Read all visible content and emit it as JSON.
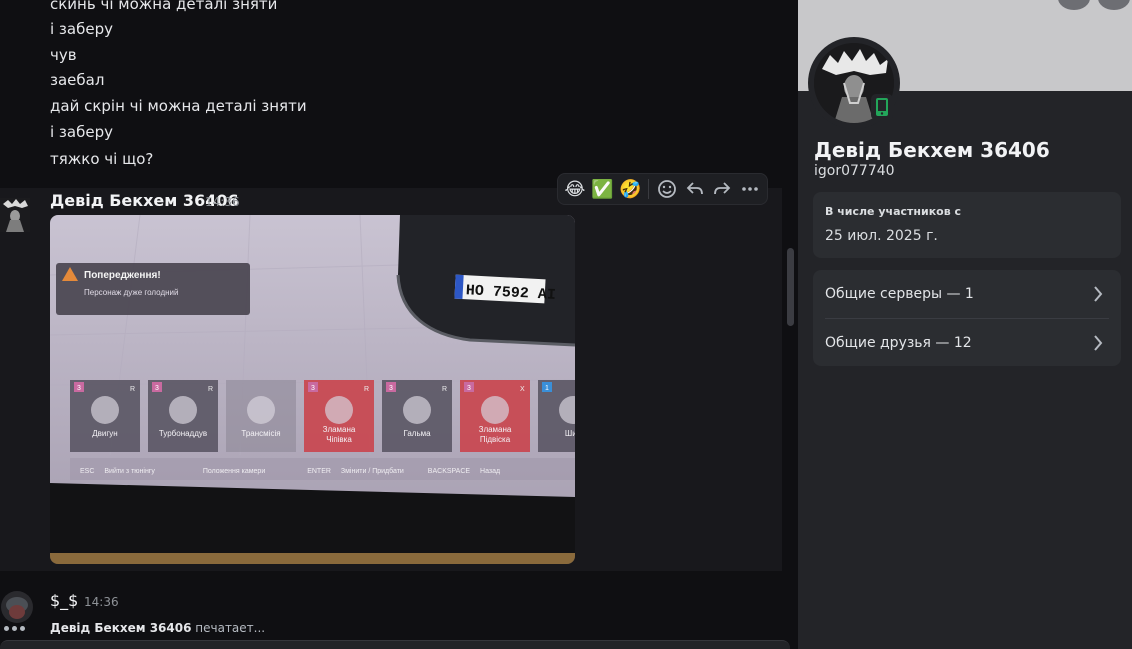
{
  "messages_above": [
    "скинь чі можна деталі зняти",
    "і заберу",
    "чув",
    "заебал",
    "дай скрін чі можна деталі зняти",
    "і заберу",
    "тяжко чі що?"
  ],
  "group": {
    "author": "Девід Бекхем  36406",
    "time": "14:36"
  },
  "attachment": {
    "warning_title": "Попередження!",
    "warning_text": "Персонаж дуже голодний",
    "plate": "НО 7592 АІ",
    "parts": [
      {
        "label": "Двигун",
        "badge": "3",
        "tag": "R"
      },
      {
        "label": "Турбонаддув",
        "badge": "3",
        "tag": "R"
      },
      {
        "label": "Трансмісія",
        "badge": "",
        "tag": ""
      },
      {
        "label": "Зламана Чіпівка",
        "badge": "3",
        "tag": "R"
      },
      {
        "label": "Гальма",
        "badge": "3",
        "tag": "R"
      },
      {
        "label": "Зламана Підвіска",
        "badge": "3",
        "tag": "X"
      },
      {
        "label": "Шин",
        "badge": "1",
        "tag": ""
      }
    ],
    "hint_bar": [
      "ESC",
      "Вийти з тюнінгу",
      "Положення камери",
      "ENTER",
      "Змінити / Придбати",
      "BACKSPACE",
      "Назад"
    ]
  },
  "toolbar": {
    "reactions": [
      "😂",
      "✅",
      "🤣"
    ],
    "icons": [
      "add-reaction-icon",
      "reply-icon",
      "forward-icon",
      "more-icon"
    ]
  },
  "message2": {
    "author": "$_$",
    "time": "14:36"
  },
  "typing": {
    "name": "Девід Бекхем 36406",
    "text": " печатает..."
  },
  "profile": {
    "display_name": "Девід Бекхем 36406",
    "username": "igor077740",
    "member_since_title": "В числе участников с",
    "member_since_value": "25 июл. 2025 г.",
    "mutual_servers": "Общие серверы — 1",
    "mutual_friends": "Общие друзья — 12"
  },
  "colors": {
    "background": "#0f0f12",
    "panel": "#232428",
    "card": "#2b2d31",
    "online_mobile": "#23a55a"
  }
}
